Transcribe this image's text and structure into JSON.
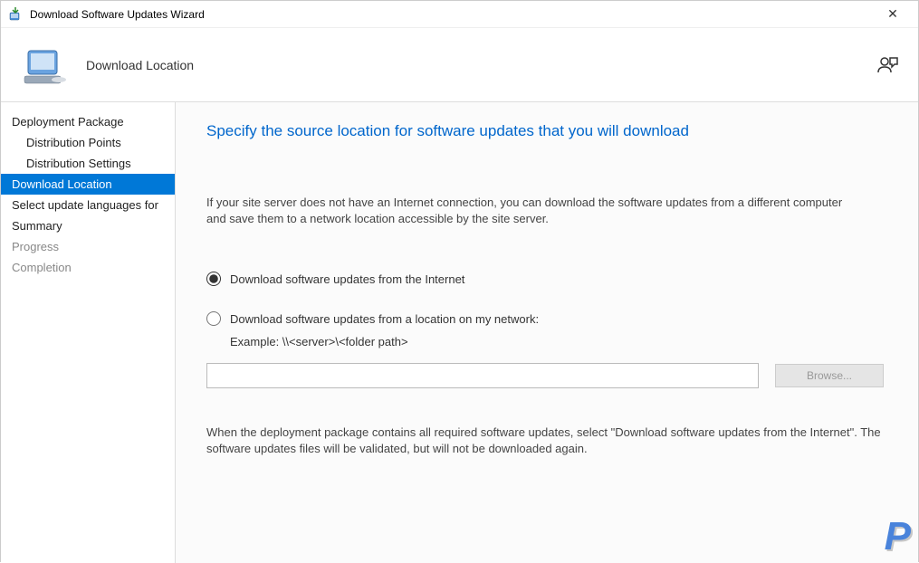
{
  "titlebar": {
    "title": "Download Software Updates Wizard"
  },
  "header": {
    "title": "Download Location"
  },
  "sidebar": {
    "items": [
      {
        "label": "Deployment Package",
        "state": "visited",
        "sub": false
      },
      {
        "label": "Distribution Points",
        "state": "visited",
        "sub": true
      },
      {
        "label": "Distribution Settings",
        "state": "visited",
        "sub": true
      },
      {
        "label": "Download Location",
        "state": "selected",
        "sub": false
      },
      {
        "label": "Select update languages for",
        "state": "visited",
        "sub": false
      },
      {
        "label": "Summary",
        "state": "visited",
        "sub": false
      },
      {
        "label": "Progress",
        "state": "upcoming",
        "sub": false
      },
      {
        "label": "Completion",
        "state": "upcoming",
        "sub": false
      }
    ]
  },
  "content": {
    "heading": "Specify the source location for software updates that you will download",
    "intro": "If your site server does not have an Internet connection, you can download the software updates from a different computer and save them to a network location accessible by the site server.",
    "option_internet": "Download software updates from the Internet",
    "option_network": "Download software updates from a location on my network:",
    "example": "Example: \\\\<server>\\<folder path>",
    "path_value": "",
    "browse_label": "Browse...",
    "note": "When the deployment package contains all required software updates, select \"Download  software updates from the Internet\". The software updates files will be validated, but will not be downloaded again.",
    "selected_option": "internet"
  },
  "watermark": "P"
}
